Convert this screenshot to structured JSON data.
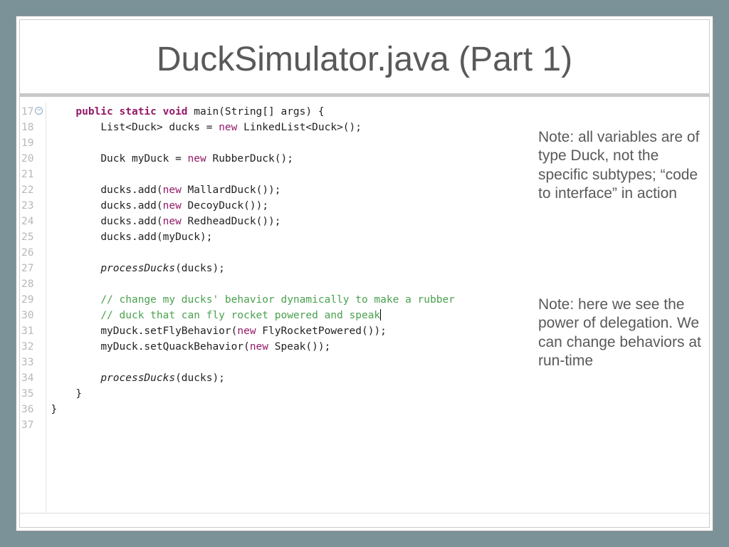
{
  "title": "DuckSimulator.java (Part 1)",
  "gutter": {
    "start": 17,
    "end": 37,
    "fold_at": 17
  },
  "code": {
    "lines": [
      {
        "n": 17,
        "indent": 1,
        "tokens": [
          [
            "kw",
            "public static void"
          ],
          [
            "txt",
            " main(String[] args) {"
          ]
        ]
      },
      {
        "n": 18,
        "indent": 2,
        "tokens": [
          [
            "txt",
            "List<Duck> ducks = "
          ],
          [
            "kw2",
            "new"
          ],
          [
            "txt",
            " LinkedList<Duck>();"
          ]
        ]
      },
      {
        "n": 19,
        "indent": 0,
        "tokens": []
      },
      {
        "n": 20,
        "indent": 2,
        "tokens": [
          [
            "txt",
            "Duck myDuck = "
          ],
          [
            "kw2",
            "new"
          ],
          [
            "txt",
            " RubberDuck();"
          ]
        ]
      },
      {
        "n": 21,
        "indent": 0,
        "tokens": []
      },
      {
        "n": 22,
        "indent": 2,
        "tokens": [
          [
            "txt",
            "ducks.add("
          ],
          [
            "kw2",
            "new"
          ],
          [
            "txt",
            " MallardDuck());"
          ]
        ]
      },
      {
        "n": 23,
        "indent": 2,
        "tokens": [
          [
            "txt",
            "ducks.add("
          ],
          [
            "kw2",
            "new"
          ],
          [
            "txt",
            " DecoyDuck());"
          ]
        ]
      },
      {
        "n": 24,
        "indent": 2,
        "tokens": [
          [
            "txt",
            "ducks.add("
          ],
          [
            "kw2",
            "new"
          ],
          [
            "txt",
            " RedheadDuck());"
          ]
        ]
      },
      {
        "n": 25,
        "indent": 2,
        "tokens": [
          [
            "txt",
            "ducks.add(myDuck);"
          ]
        ]
      },
      {
        "n": 26,
        "indent": 0,
        "tokens": []
      },
      {
        "n": 27,
        "indent": 2,
        "tokens": [
          [
            "fn",
            "processDucks"
          ],
          [
            "txt",
            "(ducks);"
          ]
        ]
      },
      {
        "n": 28,
        "indent": 0,
        "tokens": []
      },
      {
        "n": 29,
        "indent": 2,
        "tokens": [
          [
            "cm",
            "// change my ducks' behavior dynamically to make a rubber"
          ]
        ]
      },
      {
        "n": 30,
        "indent": 2,
        "tokens": [
          [
            "cm",
            "// duck that can fly rocket powered and speak"
          ]
        ],
        "highlight": true,
        "caret": true
      },
      {
        "n": 31,
        "indent": 2,
        "tokens": [
          [
            "txt",
            "myDuck.setFlyBehavior("
          ],
          [
            "kw2",
            "new"
          ],
          [
            "txt",
            " FlyRocketPowered());"
          ]
        ]
      },
      {
        "n": 32,
        "indent": 2,
        "tokens": [
          [
            "txt",
            "myDuck.setQuackBehavior("
          ],
          [
            "kw2",
            "new"
          ],
          [
            "txt",
            " Speak());"
          ]
        ]
      },
      {
        "n": 33,
        "indent": 0,
        "tokens": []
      },
      {
        "n": 34,
        "indent": 2,
        "tokens": [
          [
            "fn",
            "processDucks"
          ],
          [
            "txt",
            "(ducks);"
          ]
        ]
      },
      {
        "n": 35,
        "indent": 1,
        "tokens": [
          [
            "txt",
            "}"
          ]
        ]
      },
      {
        "n": 36,
        "indent": 0,
        "tokens": [
          [
            "txt",
            "}"
          ]
        ]
      },
      {
        "n": 37,
        "indent": 0,
        "tokens": []
      }
    ]
  },
  "notes": {
    "note1": "Note: all variables are of type Duck, not the specific subtypes; “code to interface” in action",
    "note2": "Note: here we see the power of delegation. We can change behaviors at run-time"
  }
}
